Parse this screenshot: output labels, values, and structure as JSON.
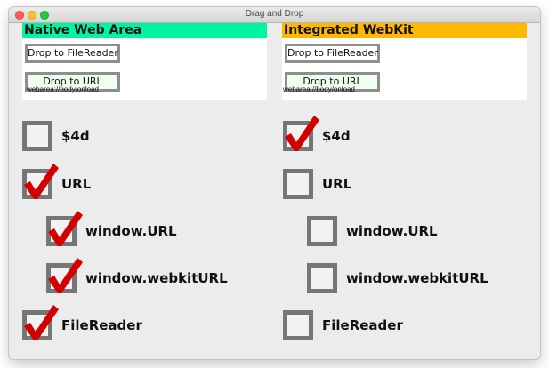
{
  "window": {
    "title": "Drag and Drop"
  },
  "panels": [
    {
      "id": "native",
      "header": "Native Web Area",
      "header_color": "#00f5a0",
      "file_button": "Drop to FileReader",
      "url_button": "Drop to URL",
      "event_log": "webarea://body/onload",
      "checks": [
        {
          "label": "$4d",
          "checked": false
        },
        {
          "label": "URL",
          "checked": true
        },
        {
          "label": "window.URL",
          "checked": true
        },
        {
          "label": "window.webkitURL",
          "checked": true
        },
        {
          "label": "FileReader",
          "checked": true
        }
      ]
    },
    {
      "id": "webkit",
      "header": "Integrated WebKit",
      "header_color": "#ffb800",
      "file_button": "Drop to FileReader",
      "url_button": "Drop to URL",
      "event_log": "webarea://body/onload",
      "checks": [
        {
          "label": "$4d",
          "checked": true
        },
        {
          "label": "URL",
          "checked": false
        },
        {
          "label": "window.URL",
          "checked": false
        },
        {
          "label": "window.webkitURL",
          "checked": false
        },
        {
          "label": "FileReader",
          "checked": false
        }
      ]
    }
  ],
  "colors": {
    "checkmark": "#d40000",
    "checkbox_border": "#767676",
    "drop_url_bg": "#efffef"
  },
  "icons": {
    "checkmark": "checkmark-icon"
  }
}
